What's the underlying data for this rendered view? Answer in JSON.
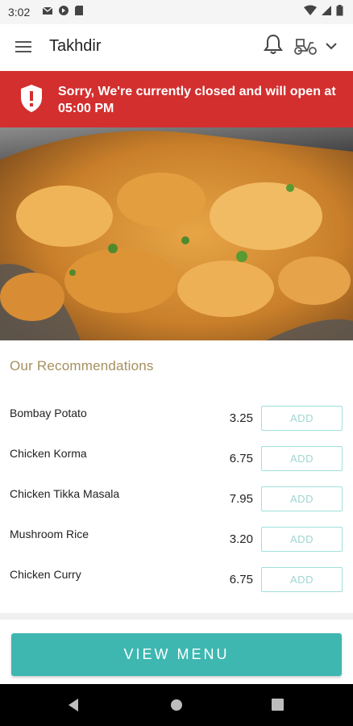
{
  "status_bar": {
    "time": "3:02"
  },
  "app_bar": {
    "title": "Takhdir"
  },
  "banner": {
    "message": "Sorry, We're currently closed and will open at 05:00 PM",
    "color": "#d32f2f"
  },
  "recommendations": {
    "title": "Our Recommendations",
    "items": [
      {
        "name": "Bombay Potato",
        "price": "3.25",
        "button": "ADD"
      },
      {
        "name": "Chicken Korma",
        "price": "6.75",
        "button": "ADD"
      },
      {
        "name": "Chicken Tikka Masala",
        "price": "7.95",
        "button": "ADD"
      },
      {
        "name": "Mushroom Rice",
        "price": "3.20",
        "button": "ADD"
      },
      {
        "name": "Chicken Curry",
        "price": "6.75",
        "button": "ADD"
      }
    ]
  },
  "footer": {
    "view_menu_label": "VIEW MENU",
    "accent_color": "#3eb7b1"
  }
}
